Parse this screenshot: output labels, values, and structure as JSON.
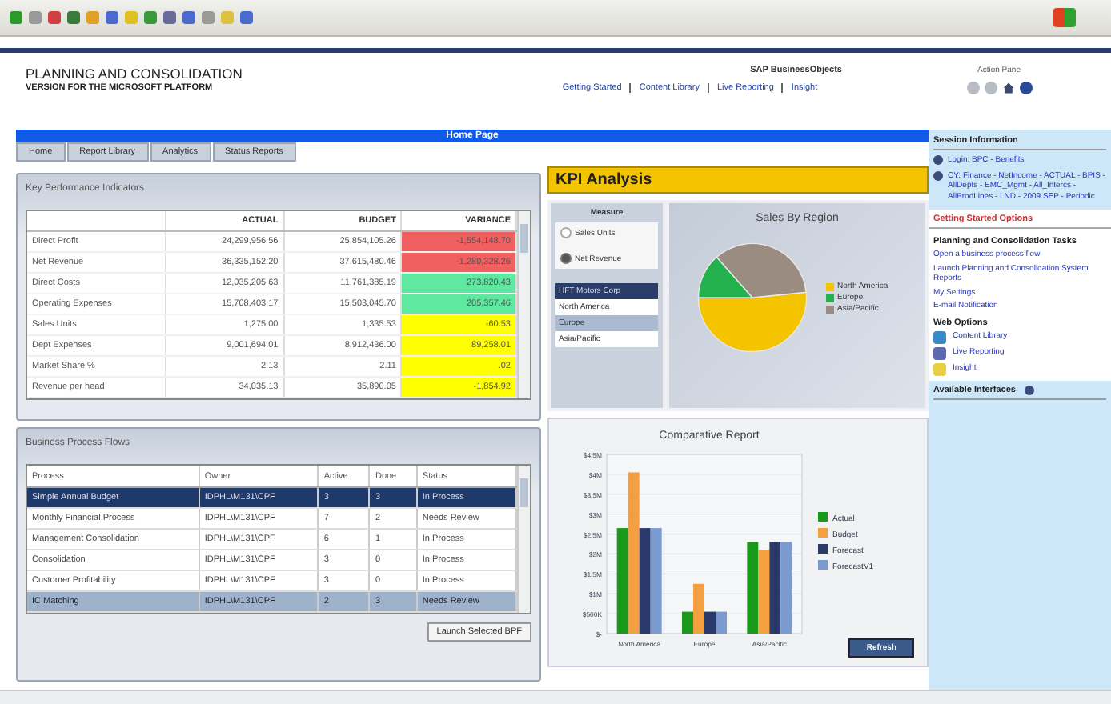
{
  "header": {
    "title": "PLANNING AND CONSOLIDATION",
    "subtitle": "VERSION FOR THE MICROSOFT PLATFORM",
    "links": [
      "Getting Started",
      "Content Library",
      "Live Reporting",
      "Insight"
    ],
    "logo": "SAP BusinessObjects",
    "action_pane": "Action Pane"
  },
  "page_title": "Home Page",
  "tabs": [
    {
      "label": "Home"
    },
    {
      "label": "Report Library"
    },
    {
      "label": "Analytics"
    },
    {
      "label": "Status Reports"
    }
  ],
  "kpi": {
    "title": "Key Performance Indicators",
    "columns": [
      "ACTUAL",
      "BUDGET",
      "VARIANCE"
    ],
    "rows": [
      {
        "name": "Direct Profit",
        "actual": "24,299,956.56",
        "budget": "25,854,105.26",
        "variance": "-1,554,148.70",
        "color": "#f06060"
      },
      {
        "name": "Net Revenue",
        "actual": "36,335,152.20",
        "budget": "37,615,480.46",
        "variance": "-1,280,328.26",
        "color": "#f06060"
      },
      {
        "name": "Direct Costs",
        "actual": "12,035,205.63",
        "budget": "11,761,385.19",
        "variance": "273,820.43",
        "color": "#5ee8a0"
      },
      {
        "name": "Operating Expenses",
        "actual": "15,708,403.17",
        "budget": "15,503,045.70",
        "variance": "205,357.46",
        "color": "#5ee8a0"
      },
      {
        "name": "Sales Units",
        "actual": "1,275.00",
        "budget": "1,335.53",
        "variance": "-60.53",
        "color": "#ffff00"
      },
      {
        "name": "Dept Expenses",
        "actual": "9,001,694.01",
        "budget": "8,912,436.00",
        "variance": "89,258.01",
        "color": "#ffff00"
      },
      {
        "name": "Market Share %",
        "actual": "2.13",
        "budget": "2.11",
        "variance": ".02",
        "color": "#ffff00"
      },
      {
        "name": "Revenue per head",
        "actual": "34,035.13",
        "budget": "35,890.05",
        "variance": "-1,854.92",
        "color": "#ffff00"
      }
    ]
  },
  "bpf": {
    "title": "Business Process Flows",
    "columns": [
      "Process",
      "Owner",
      "Active",
      "Done",
      "Status"
    ],
    "rows": [
      {
        "cells": [
          "Simple Annual Budget",
          "IDPHL\\M131\\CPF",
          "3",
          "3",
          "In Process"
        ],
        "selected": true,
        "highlighted": false
      },
      {
        "cells": [
          "Monthly Financial Process",
          "IDPHL\\M131\\CPF",
          "7",
          "2",
          "Needs Review"
        ],
        "selected": false,
        "highlighted": false
      },
      {
        "cells": [
          "Management Consolidation",
          "IDPHL\\M131\\CPF",
          "6",
          "1",
          "In Process"
        ],
        "selected": false,
        "highlighted": false
      },
      {
        "cells": [
          "Consolidation",
          "IDPHL\\M131\\CPF",
          "3",
          "0",
          "In Process"
        ],
        "selected": false,
        "highlighted": false
      },
      {
        "cells": [
          "Customer Profitability",
          "IDPHL\\M131\\CPF",
          "3",
          "0",
          "In Process"
        ],
        "selected": false,
        "highlighted": false
      },
      {
        "cells": [
          "IC Matching",
          "IDPHL\\M131\\CPF",
          "2",
          "3",
          "Needs Review"
        ],
        "selected": false,
        "highlighted": true
      }
    ],
    "button": "Launch Selected BPF"
  },
  "kpi_analysis": {
    "title": "KPI Analysis",
    "measure_label": "Measure",
    "measures": [
      {
        "label": "Sales Units",
        "selected": false
      },
      {
        "label": "Net Revenue",
        "selected": true
      }
    ],
    "entities": [
      {
        "label": "HFT Motors Corp",
        "selected": true,
        "highlighted": false
      },
      {
        "label": "North America",
        "selected": false,
        "highlighted": false
      },
      {
        "label": "Europe",
        "selected": false,
        "highlighted": true
      },
      {
        "label": "Asia/Pacific",
        "selected": false,
        "highlighted": false
      }
    ],
    "pie_title": "Sales By Region",
    "pie_legend": [
      {
        "label": "North America",
        "color": "#f5c400"
      },
      {
        "label": "Europe",
        "color": "#22b14c"
      },
      {
        "label": "Asia/Pacific",
        "color": "#9a8c80"
      }
    ]
  },
  "comparative": {
    "chart_data": {
      "type": "bar",
      "title": "Comparative Report",
      "categories": [
        "North America",
        "Europe",
        "Asia/Pacific"
      ],
      "series": [
        {
          "name": "Actual",
          "color": "#1a9a1a",
          "values": [
            2650000,
            550000,
            2300000
          ]
        },
        {
          "name": "Budget",
          "color": "#f5a040",
          "values": [
            4050000,
            1250000,
            2100000
          ]
        },
        {
          "name": "Forecast",
          "color": "#2a3a6a",
          "values": [
            2650000,
            550000,
            2300000
          ]
        },
        {
          "name": "ForecastV1",
          "color": "#7a9ad0",
          "values": [
            2650000,
            550000,
            2300000
          ]
        }
      ],
      "grid": true,
      "legend": true,
      "ylim": [
        0,
        4500000
      ],
      "yticks": [
        {
          "value": 0,
          "label": "$-"
        },
        {
          "value": 500000,
          "label": "$500K"
        },
        {
          "value": 1000000,
          "label": "$1M"
        },
        {
          "value": 1500000,
          "label": "$1.5M"
        },
        {
          "value": 2000000,
          "label": "$2M"
        },
        {
          "value": 2500000,
          "label": "$2.5M"
        },
        {
          "value": 3000000,
          "label": "$3M"
        },
        {
          "value": 3500000,
          "label": "$3.5M"
        },
        {
          "value": 4000000,
          "label": "$4M"
        },
        {
          "value": 4500000,
          "label": "$4.5M"
        }
      ]
    },
    "button": "Refresh"
  },
  "sidebar": {
    "session_title": "Session Information",
    "session_items": [
      "Login: BPC - Benefits",
      "CY: Finance - NetIncome - ACTUAL - BPIS - AllDepts - EMC_Mgmt - All_Intercs - AllProdLines - LND - 2009.SEP - Periodic"
    ],
    "getting_started": "Getting Started Options",
    "tasks_title": "Planning and Consolidation Tasks",
    "tasks": [
      "Open a business process flow",
      "Launch Planning and Consolidation System Reports",
      "My Settings",
      "E-mail Notification"
    ],
    "web_title": "Web Options",
    "web_items": [
      "Content Library",
      "Live Reporting",
      "Insight"
    ],
    "interfaces_title": "Available Interfaces"
  }
}
